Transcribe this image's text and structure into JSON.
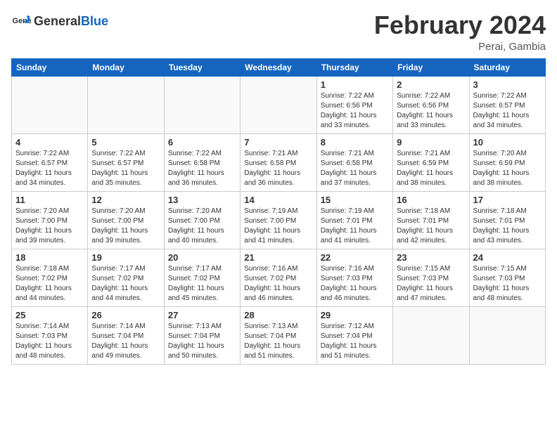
{
  "header": {
    "logo_general": "General",
    "logo_blue": "Blue",
    "title": "February 2024",
    "location": "Perai, Gambia"
  },
  "weekdays": [
    "Sunday",
    "Monday",
    "Tuesday",
    "Wednesday",
    "Thursday",
    "Friday",
    "Saturday"
  ],
  "weeks": [
    [
      {
        "day": "",
        "info": ""
      },
      {
        "day": "",
        "info": ""
      },
      {
        "day": "",
        "info": ""
      },
      {
        "day": "",
        "info": ""
      },
      {
        "day": "1",
        "info": "Sunrise: 7:22 AM\nSunset: 6:56 PM\nDaylight: 11 hours\nand 33 minutes."
      },
      {
        "day": "2",
        "info": "Sunrise: 7:22 AM\nSunset: 6:56 PM\nDaylight: 11 hours\nand 33 minutes."
      },
      {
        "day": "3",
        "info": "Sunrise: 7:22 AM\nSunset: 6:57 PM\nDaylight: 11 hours\nand 34 minutes."
      }
    ],
    [
      {
        "day": "4",
        "info": "Sunrise: 7:22 AM\nSunset: 6:57 PM\nDaylight: 11 hours\nand 34 minutes."
      },
      {
        "day": "5",
        "info": "Sunrise: 7:22 AM\nSunset: 6:57 PM\nDaylight: 11 hours\nand 35 minutes."
      },
      {
        "day": "6",
        "info": "Sunrise: 7:22 AM\nSunset: 6:58 PM\nDaylight: 11 hours\nand 36 minutes."
      },
      {
        "day": "7",
        "info": "Sunrise: 7:21 AM\nSunset: 6:58 PM\nDaylight: 11 hours\nand 36 minutes."
      },
      {
        "day": "8",
        "info": "Sunrise: 7:21 AM\nSunset: 6:58 PM\nDaylight: 11 hours\nand 37 minutes."
      },
      {
        "day": "9",
        "info": "Sunrise: 7:21 AM\nSunset: 6:59 PM\nDaylight: 11 hours\nand 38 minutes."
      },
      {
        "day": "10",
        "info": "Sunrise: 7:20 AM\nSunset: 6:59 PM\nDaylight: 11 hours\nand 38 minutes."
      }
    ],
    [
      {
        "day": "11",
        "info": "Sunrise: 7:20 AM\nSunset: 7:00 PM\nDaylight: 11 hours\nand 39 minutes."
      },
      {
        "day": "12",
        "info": "Sunrise: 7:20 AM\nSunset: 7:00 PM\nDaylight: 11 hours\nand 39 minutes."
      },
      {
        "day": "13",
        "info": "Sunrise: 7:20 AM\nSunset: 7:00 PM\nDaylight: 11 hours\nand 40 minutes."
      },
      {
        "day": "14",
        "info": "Sunrise: 7:19 AM\nSunset: 7:00 PM\nDaylight: 11 hours\nand 41 minutes."
      },
      {
        "day": "15",
        "info": "Sunrise: 7:19 AM\nSunset: 7:01 PM\nDaylight: 11 hours\nand 41 minutes."
      },
      {
        "day": "16",
        "info": "Sunrise: 7:18 AM\nSunset: 7:01 PM\nDaylight: 11 hours\nand 42 minutes."
      },
      {
        "day": "17",
        "info": "Sunrise: 7:18 AM\nSunset: 7:01 PM\nDaylight: 11 hours\nand 43 minutes."
      }
    ],
    [
      {
        "day": "18",
        "info": "Sunrise: 7:18 AM\nSunset: 7:02 PM\nDaylight: 11 hours\nand 44 minutes."
      },
      {
        "day": "19",
        "info": "Sunrise: 7:17 AM\nSunset: 7:02 PM\nDaylight: 11 hours\nand 44 minutes."
      },
      {
        "day": "20",
        "info": "Sunrise: 7:17 AM\nSunset: 7:02 PM\nDaylight: 11 hours\nand 45 minutes."
      },
      {
        "day": "21",
        "info": "Sunrise: 7:16 AM\nSunset: 7:02 PM\nDaylight: 11 hours\nand 46 minutes."
      },
      {
        "day": "22",
        "info": "Sunrise: 7:16 AM\nSunset: 7:03 PM\nDaylight: 11 hours\nand 46 minutes."
      },
      {
        "day": "23",
        "info": "Sunrise: 7:15 AM\nSunset: 7:03 PM\nDaylight: 11 hours\nand 47 minutes."
      },
      {
        "day": "24",
        "info": "Sunrise: 7:15 AM\nSunset: 7:03 PM\nDaylight: 11 hours\nand 48 minutes."
      }
    ],
    [
      {
        "day": "25",
        "info": "Sunrise: 7:14 AM\nSunset: 7:03 PM\nDaylight: 11 hours\nand 48 minutes."
      },
      {
        "day": "26",
        "info": "Sunrise: 7:14 AM\nSunset: 7:04 PM\nDaylight: 11 hours\nand 49 minutes."
      },
      {
        "day": "27",
        "info": "Sunrise: 7:13 AM\nSunset: 7:04 PM\nDaylight: 11 hours\nand 50 minutes."
      },
      {
        "day": "28",
        "info": "Sunrise: 7:13 AM\nSunset: 7:04 PM\nDaylight: 11 hours\nand 51 minutes."
      },
      {
        "day": "29",
        "info": "Sunrise: 7:12 AM\nSunset: 7:04 PM\nDaylight: 11 hours\nand 51 minutes."
      },
      {
        "day": "",
        "info": ""
      },
      {
        "day": "",
        "info": ""
      }
    ]
  ]
}
